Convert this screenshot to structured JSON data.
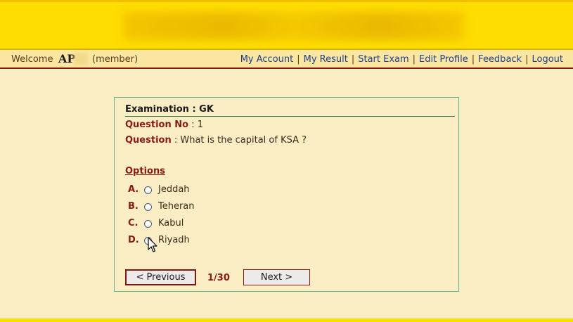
{
  "nav": {
    "welcome": "Welcome",
    "logo": "AP",
    "member": "(member)",
    "links": [
      "My Account",
      "My Result",
      "Start Exam",
      "Edit Profile",
      "Feedback",
      "Logout"
    ],
    "separator": "|"
  },
  "exam": {
    "title": "Examination : GK",
    "question_no_label": "Question No",
    "question_no_value": ": 1",
    "question_label": "Question",
    "question_text": ": What is the capital of KSA ?",
    "options_label": "Options",
    "options": [
      {
        "letter": "A.",
        "text": "Jeddah"
      },
      {
        "letter": "B.",
        "text": "Teheran"
      },
      {
        "letter": "C.",
        "text": "Kabul"
      },
      {
        "letter": "D.",
        "text": "Riyadh"
      }
    ],
    "prev_label": "< Previous",
    "page_indicator": "1/30",
    "next_label": "Next >"
  },
  "colors": {
    "banner": "#ffdd00",
    "background": "#fbeec4",
    "accent": "#8b1a12",
    "link": "#1f3d8c",
    "card_border": "#5fb88a"
  },
  "icons": {
    "cursor": "mouse-pointer-icon"
  }
}
